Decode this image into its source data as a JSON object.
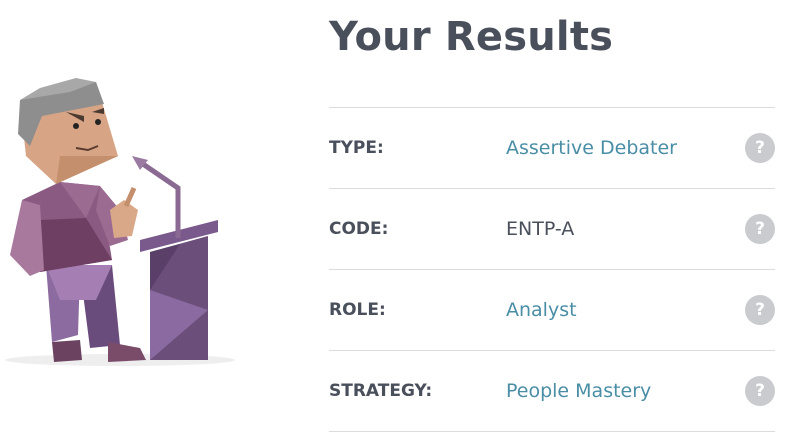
{
  "header": {
    "title": "Your Results"
  },
  "results": [
    {
      "label": "TYPE:",
      "value": "Assertive Debater",
      "linked": true,
      "help": "?"
    },
    {
      "label": "CODE:",
      "value": "ENTP-A",
      "linked": false,
      "help": "?"
    },
    {
      "label": "ROLE:",
      "value": "Analyst",
      "linked": true,
      "help": "?"
    },
    {
      "label": "STRATEGY:",
      "value": "People Mastery",
      "linked": true,
      "help": "?"
    }
  ],
  "colors": {
    "title": "#4a4f5c",
    "link": "#4a8ea6",
    "help_badge": "#c9cbcf",
    "divider": "#dcdcdc",
    "character_purple": "#8b5a82",
    "podium": "#6b4f7a"
  },
  "illustration": {
    "icon": "debater-at-podium-icon"
  }
}
